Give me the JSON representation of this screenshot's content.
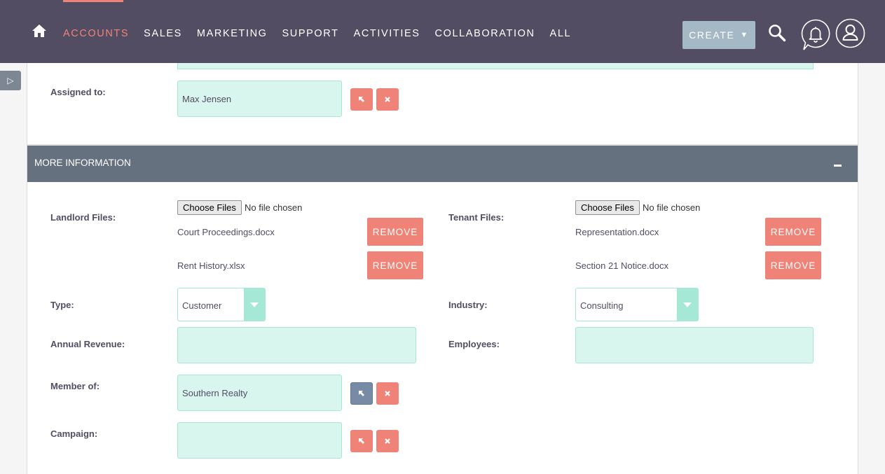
{
  "nav": {
    "items": [
      {
        "label": "ACCOUNTS",
        "active": true
      },
      {
        "label": "SALES"
      },
      {
        "label": "MARKETING"
      },
      {
        "label": "SUPPORT"
      },
      {
        "label": "ACTIVITIES"
      },
      {
        "label": "COLLABORATION"
      },
      {
        "label": "ALL"
      }
    ],
    "create_label": "CREATE",
    "icons": [
      "home-icon",
      "search-icon",
      "bell-icon",
      "user-icon"
    ]
  },
  "sidebar_toggle": {
    "glyph": "▷"
  },
  "overview": {
    "assigned_to_label": "Assigned to:",
    "assigned_to_value": "Max Jensen"
  },
  "more_info": {
    "title": "MORE INFORMATION",
    "landlord_files_label": "Landlord Files:",
    "tenant_files_label": "Tenant Files:",
    "choose_files_label": "Choose Files",
    "no_file_text": "No file chosen",
    "landlord_files": [
      "Court Proceedings.docx",
      "Rent History.xlsx"
    ],
    "tenant_files": [
      "Representation.docx",
      "Section 21 Notice.docx"
    ],
    "remove_label": "REMOVE",
    "type_label": "Type:",
    "type_value": "Customer",
    "industry_label": "Industry:",
    "industry_value": "Consulting",
    "annual_revenue_label": "Annual Revenue:",
    "annual_revenue_value": "",
    "employees_label": "Employees:",
    "employees_value": "",
    "member_of_label": "Member of:",
    "member_of_value": "Southern Realty",
    "campaign_label": "Campaign:",
    "campaign_value": ""
  },
  "colors": {
    "nav_bg": "#534d64",
    "accent": "#f08377",
    "field_bg": "#d8f5ee",
    "field_border": "#a5e8d6",
    "panel_header": "#667180",
    "create_bg": "#a5b8c6"
  }
}
